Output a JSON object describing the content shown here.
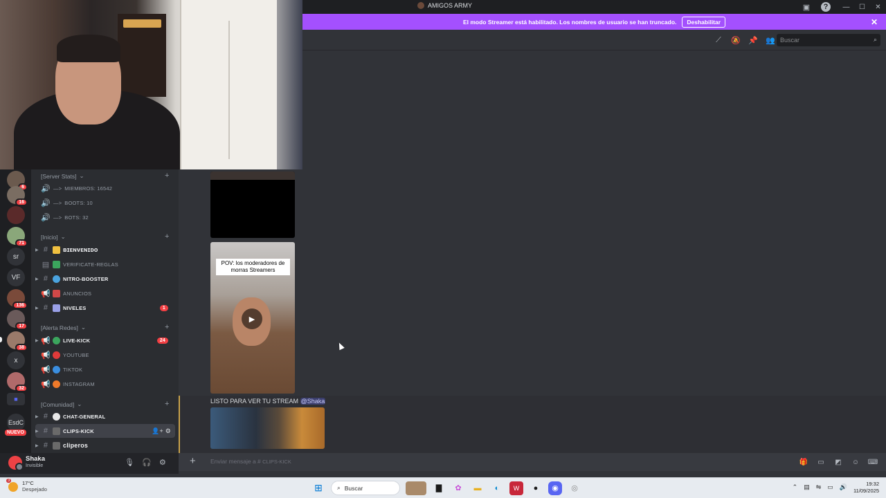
{
  "window": {
    "title": "AMIGOS ARMY"
  },
  "banner": {
    "message": "El modo Streamer está habilitado. Los nombres de usuario se han truncado.",
    "button": "Deshabilitar"
  },
  "header": {
    "search_placeholder": "Buscar"
  },
  "servers": [
    {
      "badge": "6"
    },
    {
      "badge": "16"
    },
    {
      "badge": ""
    },
    {
      "badge": "71"
    },
    {
      "label": "sr"
    },
    {
      "label": "VF"
    },
    {
      "badge": "136"
    },
    {
      "badge": "17"
    },
    {
      "badge": "38"
    },
    {
      "label": "x"
    },
    {
      "badge": "32"
    },
    {
      "label": "EsdC"
    }
  ],
  "server_badge_new": "NUEVO",
  "categories": [
    {
      "name": "[Server Stats]"
    },
    {
      "name": "[Inicio]"
    },
    {
      "name": "[Alerta Redes]"
    },
    {
      "name": "[Comunidad]"
    }
  ],
  "channels": {
    "stats": [
      {
        "prefix": "—>",
        "name": "miembros: 16542"
      },
      {
        "prefix": "—>",
        "name": "boots: 10"
      },
      {
        "prefix": "—>",
        "name": "bots: 32"
      }
    ],
    "inicio": [
      {
        "name": "ʙɪᴇɴᴠᴇɴɪᴅᴏ",
        "badge": ""
      },
      {
        "name": "verificate-reglas",
        "badge": ""
      },
      {
        "name": "nitro-booster",
        "badge": ""
      },
      {
        "name": "anuncios",
        "badge": ""
      },
      {
        "name": "niveles",
        "badge": "1"
      }
    ],
    "alertas": [
      {
        "name": "live-kick",
        "badge": "24"
      },
      {
        "name": "youtube",
        "badge": ""
      },
      {
        "name": "tiktok",
        "badge": ""
      },
      {
        "name": "instagram",
        "badge": ""
      }
    ],
    "comunidad": [
      {
        "name": "chat-general"
      },
      {
        "name": "clips-kick"
      },
      {
        "name": "clipеros"
      }
    ]
  },
  "user": {
    "name": "Shaka",
    "status": "Invisible"
  },
  "messages": {
    "video_caption": "POV: los moderadores de morras Streamers",
    "text": "LISTO PARA VER TU STREAM",
    "mention": "@Shaka"
  },
  "composer": {
    "placeholder": "Enviar mensaje a #",
    "channel": "clips-kick"
  },
  "taskbar": {
    "temperature": "17°C",
    "condition": "Despejado",
    "weather_badge": "3",
    "search": "Buscar",
    "time": "19:32",
    "date": "11/09/2025"
  }
}
